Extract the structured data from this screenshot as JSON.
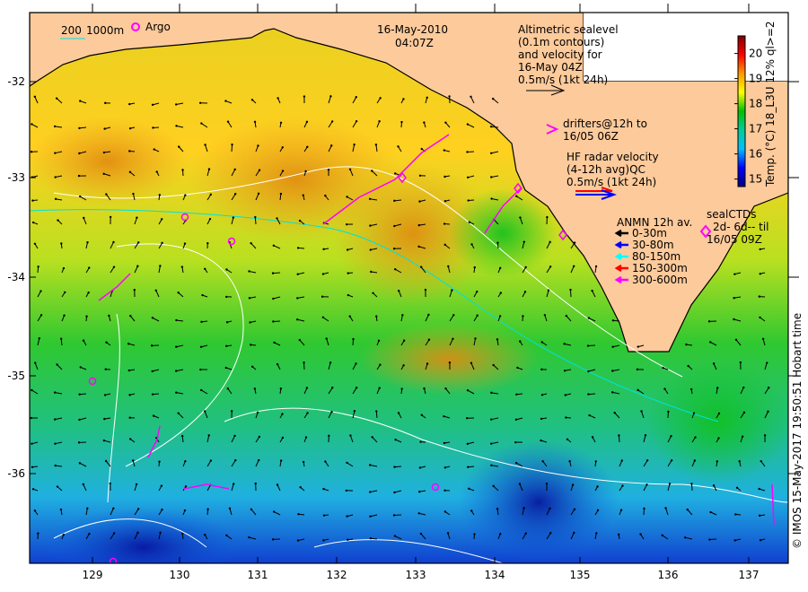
{
  "title": {
    "date": "16-May-2010",
    "time": "04:07Z"
  },
  "bathymetry_legend": {
    "contour1": "200",
    "contour2": "1000m"
  },
  "argo_legend": {
    "label": "Argo",
    "color": "#ff00ff"
  },
  "altimetry_legend": {
    "lines": [
      "Altimetric sealevel",
      "(0.1m contours)",
      "and velocity for",
      "16-May 04Z",
      "0.5m/s (1kt 24h)"
    ]
  },
  "drifters_legend": {
    "lines": [
      "drifters@12h to",
      "16/05 06Z"
    ],
    "color": "#ff00ff"
  },
  "hf_radar_legend": {
    "lines": [
      "HF radar velocity",
      "(4-12h avg)QC",
      "0.5m/s (1kt 24h)"
    ]
  },
  "anmn_legend": {
    "title": "ANMN 12h av.",
    "items": [
      {
        "label": "0-30m",
        "color": "#000000"
      },
      {
        "label": "30-80m",
        "color": "#0000ff"
      },
      {
        "label": "80-150m",
        "color": "#00ffff"
      },
      {
        "label": "150-300m",
        "color": "#ff0000"
      },
      {
        "label": "300-600m",
        "color": "#ff00ff"
      }
    ]
  },
  "seal_ctd_legend": {
    "title": "sealCTDs",
    "lines": [
      "2d- 6d-- til",
      "16/05 09Z"
    ],
    "color": "#ff00ff"
  },
  "colorbar": {
    "label": "Temp. (°C) 18_L3U 12% ql>=2",
    "ticks": [
      "15",
      "16",
      "17",
      "18",
      "19",
      "20"
    ],
    "range": [
      14.7,
      20.7
    ],
    "colors": [
      "#00007f",
      "#0000ff",
      "#00bfff",
      "#00cc99",
      "#00c000",
      "#ffff00",
      "#ff9900",
      "#ff0000",
      "#7f0000"
    ]
  },
  "axes": {
    "lon_ticks": [
      "129",
      "130",
      "131",
      "132",
      "133",
      "134",
      "135",
      "136",
      "137"
    ],
    "lat_ticks": [
      "-32",
      "-33",
      "-34",
      "-35",
      "-36"
    ]
  },
  "credit": "© IMOS 15-May-2017 19:50:51 Hobart time",
  "colors": {
    "land": "#fdca9b",
    "coast": "#000000",
    "contour": "#ffffff"
  }
}
